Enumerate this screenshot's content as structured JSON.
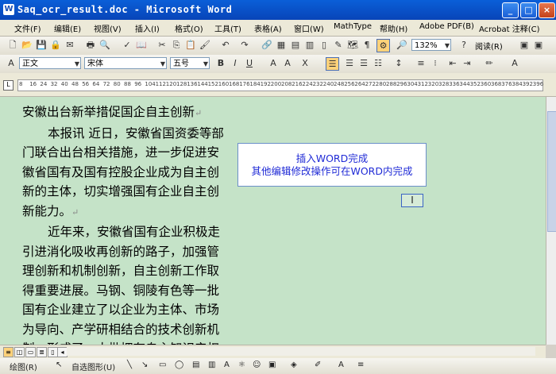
{
  "window": {
    "title": "Saq_ocr_result.doc - Microsoft Word",
    "minimize": "_",
    "maximize": "□",
    "close": "×",
    "app_icon": "W"
  },
  "menu": {
    "items": [
      "文件(F)",
      "编辑(E)",
      "视图(V)",
      "插入(I)",
      "格式(O)",
      "工具(T)",
      "表格(A)",
      "窗口(W)",
      "MathType",
      "帮助(H)",
      "Adobe PDF(B)",
      "Acrobat 注释(C)"
    ]
  },
  "toolbar": {
    "zoom": "132%",
    "read_label": "阅读(R)"
  },
  "format": {
    "style": "正文",
    "font": "宋体",
    "size": "五号"
  },
  "ruler": {
    "ticks": [
      "8",
      "16",
      "24",
      "32",
      "40",
      "48",
      "56",
      "64",
      "72",
      "80",
      "88",
      "96",
      "104",
      "112",
      "120",
      "128",
      "136",
      "144",
      "152",
      "160",
      "168",
      "176",
      "184",
      "192",
      "200",
      "208",
      "216",
      "224",
      "232",
      "240",
      "248",
      "256",
      "264",
      "272",
      "280",
      "288",
      "296",
      "304",
      "312",
      "320",
      "328",
      "336",
      "344",
      "352",
      "360",
      "368",
      "376",
      "384",
      "392",
      "396"
    ]
  },
  "document": {
    "paragraphs": [
      {
        "text": "安徽出台新举措促国企自主创新",
        "indent": false
      },
      {
        "text": "本报讯 近日，安徽省国资委等部门联合出台相关措施，进一步促进安徽省国有及国有控股企业成为自主创新的主体，切实增强国有企业自主创新能力。",
        "indent": true
      },
      {
        "text": "近年来，安徽省国有企业积极走引进消化吸收再创新的路子，加强管理创新和机制创新，自主创新工作取得重要进展。马钢、铜陵有色等一批国有企业建立了以企业为主体、市场为导向、产学研相结合的技术创新机制，形成了一大批拥有自主知识产权",
        "indent": true
      }
    ],
    "paragraph_mark": "↵"
  },
  "popup": {
    "line1": "插入WORD完成",
    "line2": "其他编辑修改操作可在WORD内完成"
  },
  "drawing": {
    "draw_label": "绘图(R)",
    "autoshape_label": "自选图形(U)"
  }
}
